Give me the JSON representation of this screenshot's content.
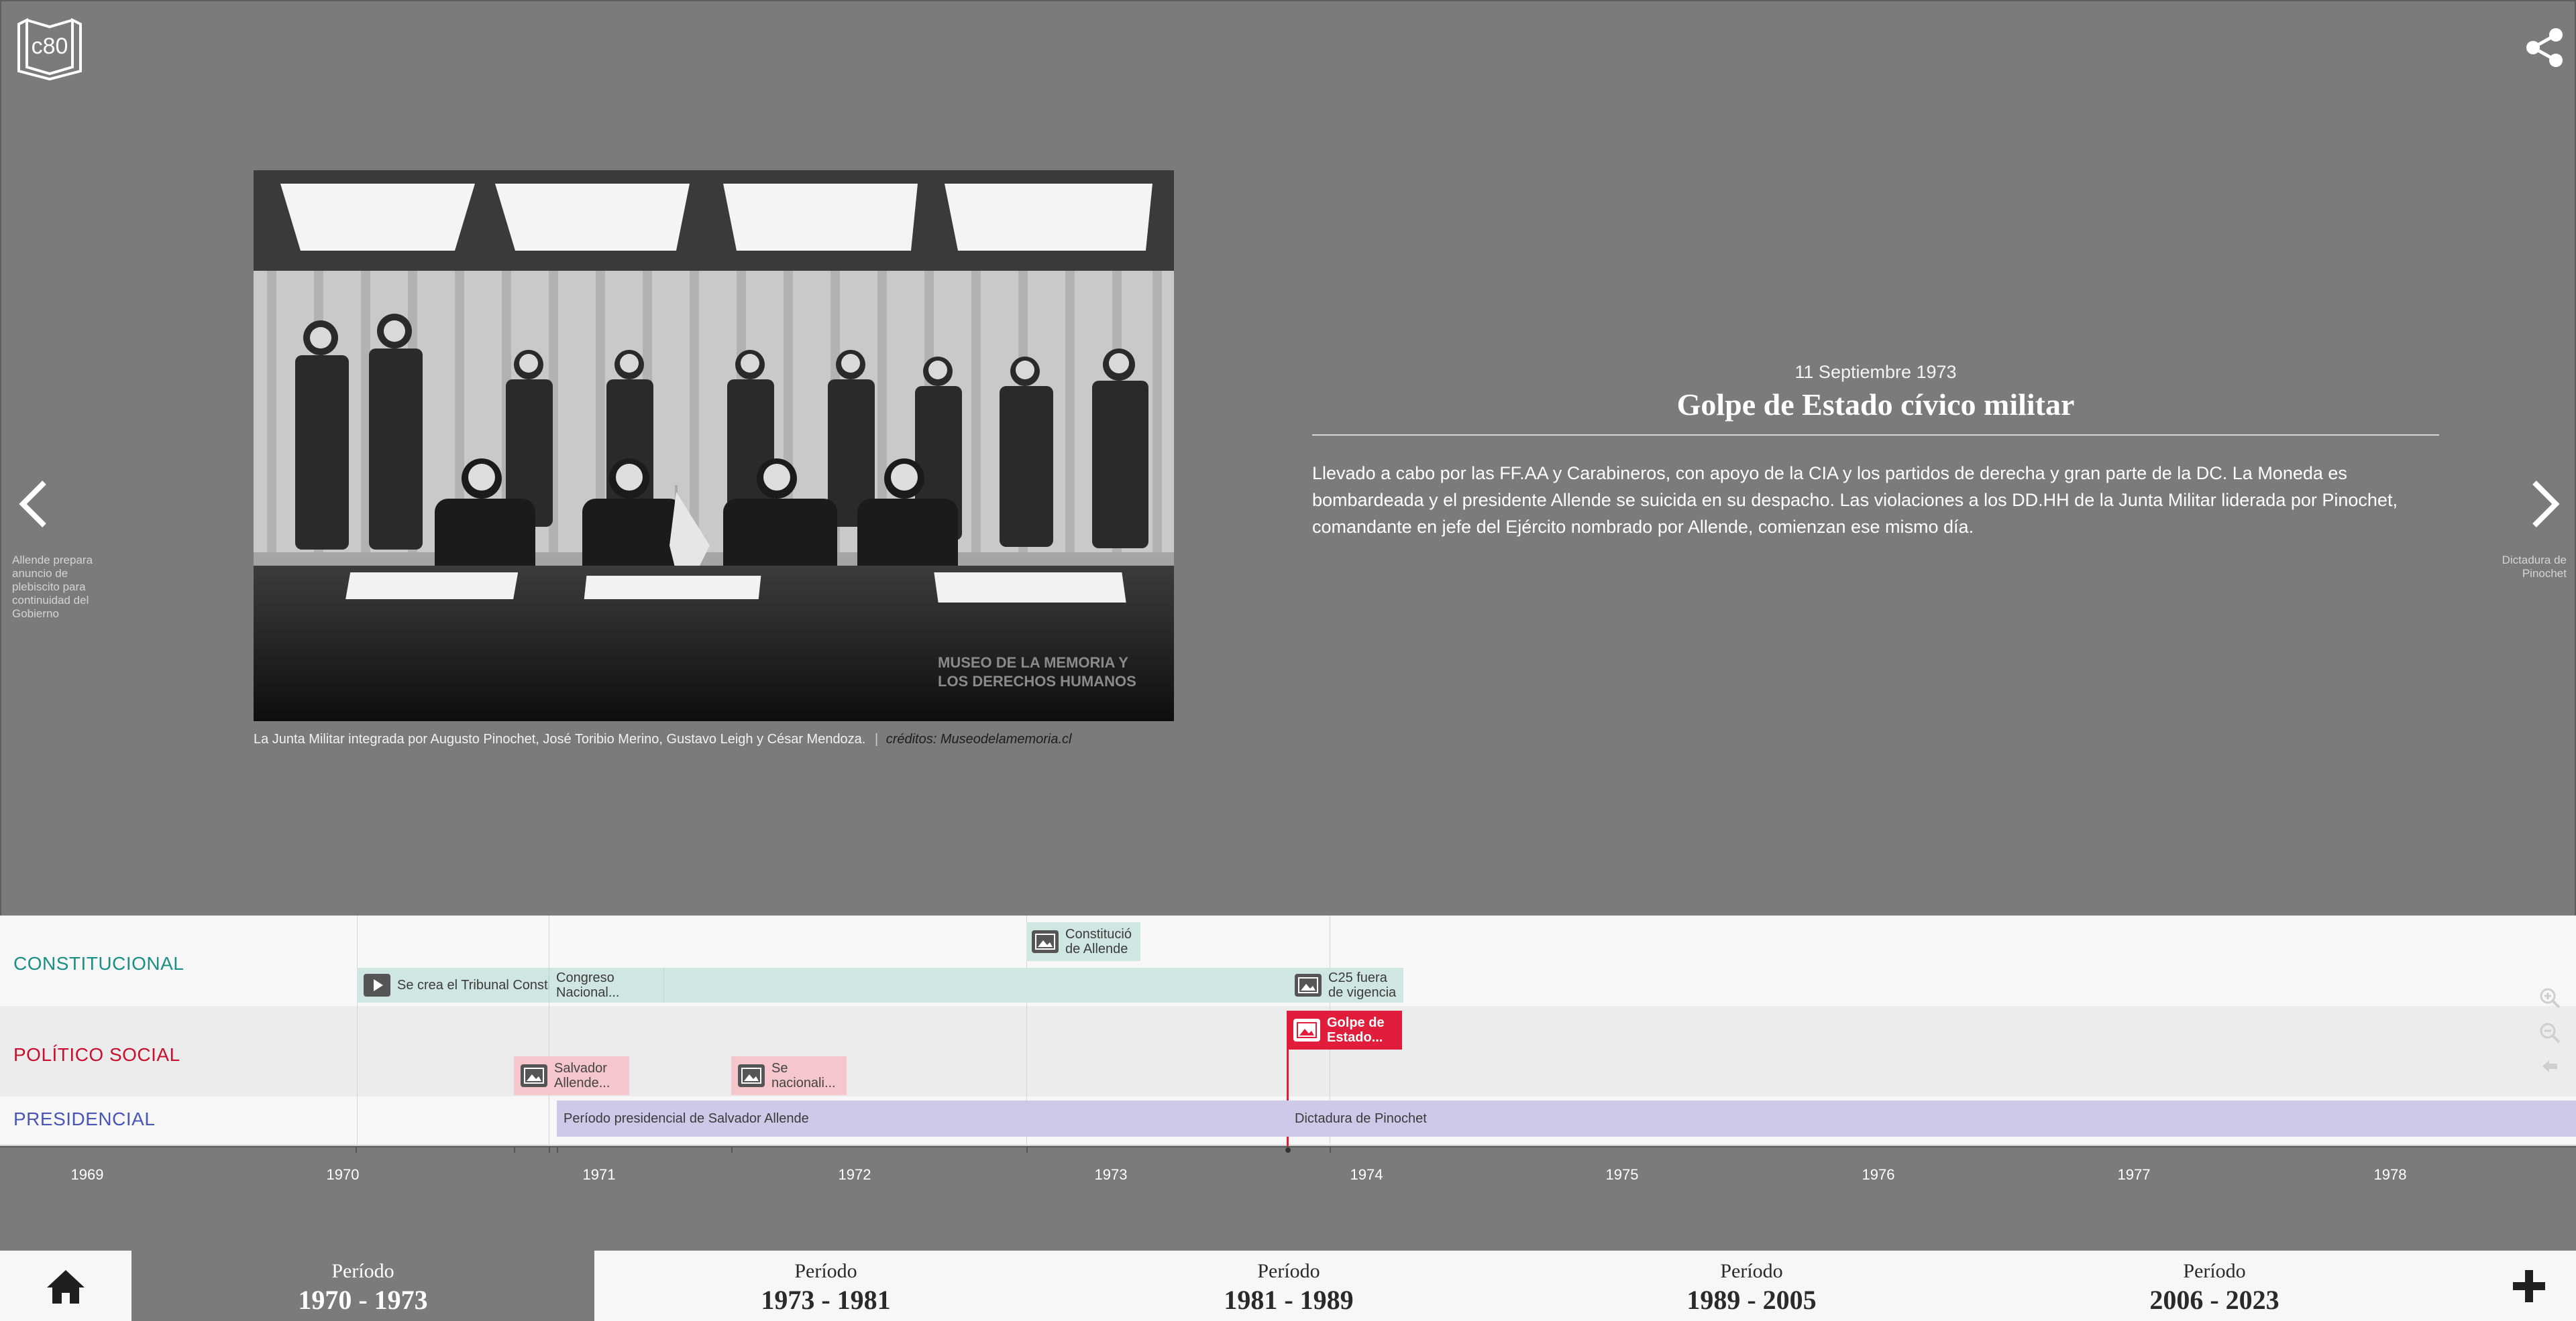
{
  "header": {
    "logo_text": "c80",
    "share_icon": "share-icon"
  },
  "navigation": {
    "prev_label": "Allende prepara anuncio de plebiscito para continuidad del Gobierno",
    "next_label": "Dictadura de Pinochet"
  },
  "slide": {
    "date": "11 Septiembre 1973",
    "title": "Golpe de Estado cívico militar",
    "body": "Llevado a cabo por las FF.AA y Carabineros, con apoyo de la CIA y los partidos de derecha y gran parte de la DC. La Moneda es bombardeada y el presidente Allende se suicida en su despacho. Las violaciones a los DD.HH de la Junta Militar liderada por Pinochet, comandante en jefe del Ejército nombrado por Allende, comienzan ese mismo día.",
    "caption": "La Junta Militar integrada por Augusto Pinochet, José Toribio Merino, Gustavo Leigh y César Mendoza.",
    "credit_separator": "|",
    "credit": "créditos: Museodelamemoria.cl",
    "watermark_line1": "MUSEO DE LA MEMORIA Y",
    "watermark_line2": "LOS DERECHOS HUMANOS"
  },
  "timeline": {
    "groups": {
      "constitucional": "CONSTITUCIONAL",
      "politico_social": "POLÍTICO SOCIAL",
      "presidencial": "PRESIDENCIAL"
    },
    "events": {
      "tribunal": "Se crea el Tribunal Consti",
      "congreso_1": "Congreso",
      "congreso_2": "Nacional...",
      "constitucion_1": "Constitució",
      "constitucion_2": "de Allende",
      "c25_1": "C25 fuera",
      "c25_2": "de vigencia",
      "golpe_1": "Golpe de",
      "golpe_2": "Estado...",
      "salvador_1": "Salvador",
      "salvador_2": "Allende...",
      "nacionali_1": "Se",
      "nacionali_2": "nacionali...",
      "periodo_allende": "Período presidencial de Salvador Allende",
      "dictadura": "Dictadura de Pinochet"
    },
    "years": [
      "1969",
      "1970",
      "1971",
      "1972",
      "1973",
      "1974",
      "1975",
      "1976",
      "1977",
      "1978"
    ],
    "zoom_controls": [
      "zoom-in-icon",
      "zoom-out-icon",
      "back-icon"
    ]
  },
  "periods": [
    {
      "label": "Período",
      "range": "1970 - 1973",
      "active": true
    },
    {
      "label": "Período",
      "range": "1973 - 1981",
      "active": false
    },
    {
      "label": "Período",
      "range": "1981 - 1989",
      "active": false
    },
    {
      "label": "Período",
      "range": "1989 - 2005",
      "active": false
    },
    {
      "label": "Período",
      "range": "2006 - 2023",
      "active": false
    }
  ],
  "colors": {
    "background": "#7b7b7b",
    "constitucional": "#1a8f86",
    "politico_social": "#c8102e",
    "presidencial": "#4a56b5",
    "active_event": "#e01d3a"
  }
}
